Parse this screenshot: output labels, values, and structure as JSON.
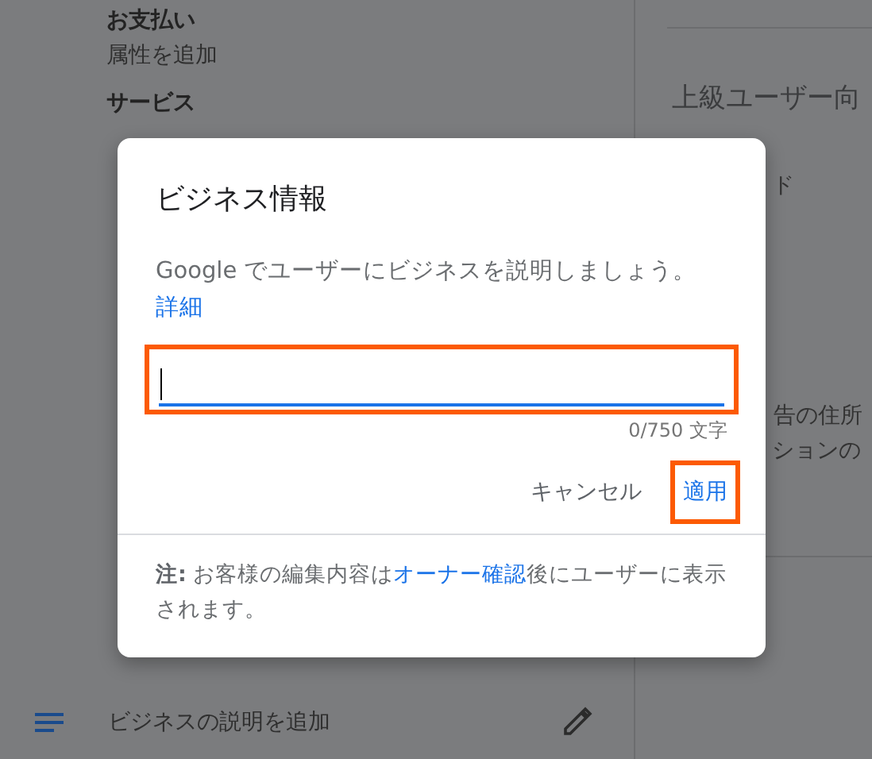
{
  "attributes": [
    {
      "title": "お支払い",
      "action": "属性を追加"
    },
    {
      "title": "サービス"
    }
  ],
  "side_panel": {
    "heading": "上級ユーザー向",
    "texts": [
      "ド",
      "告の住所",
      "ションの"
    ]
  },
  "description_row": {
    "label": "ビジネスの説明を追加"
  },
  "dialog": {
    "title": "ビジネス情報",
    "description": "Google でユーザーにビジネスを説明しましょう。",
    "link": "詳細",
    "field": {
      "focused": true,
      "highlighted": true
    },
    "counter": "0/750 文字",
    "buttons": [
      {
        "label": "キャンセル",
        "kind": "text",
        "highlighted": false
      },
      {
        "label": "適用",
        "kind": "primary",
        "highlighted": true
      }
    ],
    "note": {
      "label": "注:",
      "before": "お客様の編集内容は",
      "link": "オーナー確認",
      "after": "後にユーザーに表示されます。"
    }
  }
}
